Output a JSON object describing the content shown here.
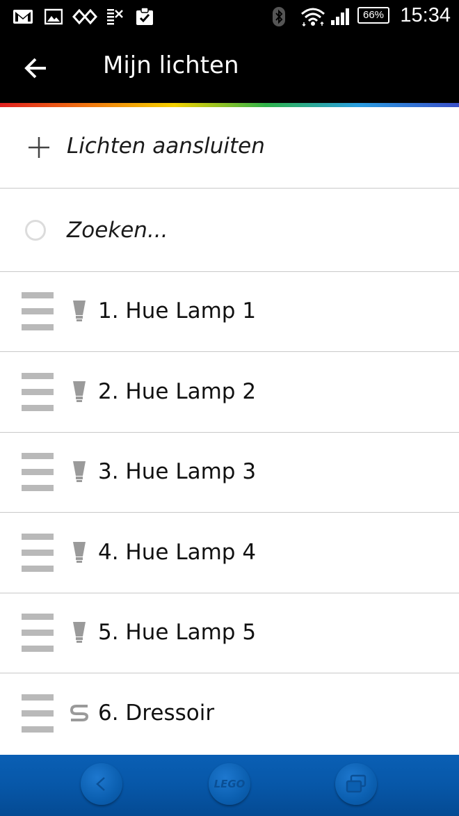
{
  "status_bar": {
    "time": "15:34",
    "battery": "66%",
    "icons": [
      "gmail-icon",
      "image-icon",
      "sync-icon",
      "sim-icon",
      "clipboard-check-icon",
      "bluetooth-icon",
      "wifi-icon",
      "signal-icon",
      "battery-icon"
    ]
  },
  "toolbar": {
    "title": "Mijn lichten",
    "back_icon": "back-arrow-icon"
  },
  "actions": {
    "connect_label": "Lichten aansluiten",
    "search_label": "Zoeken..."
  },
  "lights": [
    {
      "label": "1. Hue Lamp 1",
      "icon": "bulb-icon"
    },
    {
      "label": "2. Hue Lamp 2",
      "icon": "bulb-icon"
    },
    {
      "label": "3. Hue Lamp 3",
      "icon": "bulb-icon"
    },
    {
      "label": "4. Hue Lamp 4",
      "icon": "bulb-icon"
    },
    {
      "label": "5. Hue Lamp 5",
      "icon": "bulb-icon"
    },
    {
      "label": "6. Dressoir",
      "icon": "lightstrip-icon"
    }
  ],
  "nav_bar": {
    "home_label": "LEGO",
    "buttons": [
      "nav-back-icon",
      "home-icon",
      "recent-apps-icon"
    ]
  },
  "colors": {
    "toolbar_bg": "#000000",
    "nav_bg": "#0757a8",
    "divider": "#c8c8c8",
    "drag_handle": "#b9b9b9"
  }
}
